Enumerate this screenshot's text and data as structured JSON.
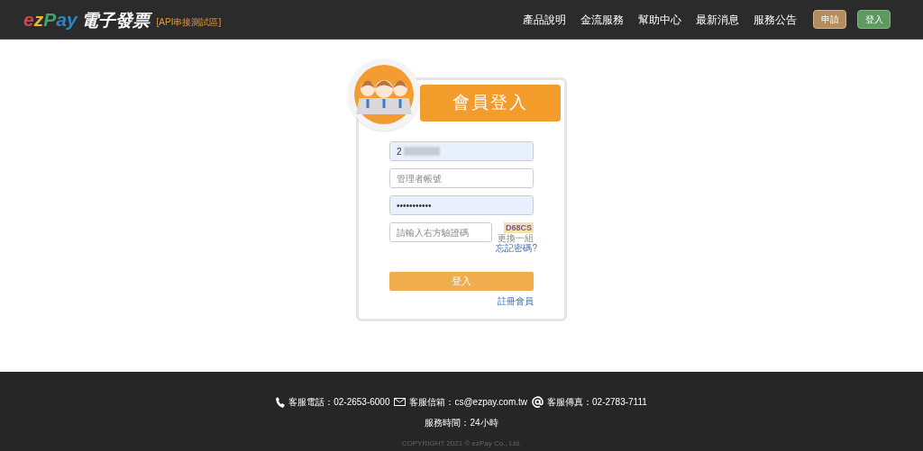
{
  "header": {
    "logo": {
      "letters": [
        {
          "text": "e",
          "color": "#d6424f"
        },
        {
          "text": "z",
          "color": "#e8b730"
        },
        {
          "text": "P",
          "color": "#3fa66b"
        },
        {
          "text": "a",
          "color": "#2a86c8"
        },
        {
          "text": "y",
          "color": "#2a86c8"
        }
      ],
      "title": "電子發票",
      "tag": "[API串接測試區]"
    },
    "nav": [
      "產品說明",
      "金流服務",
      "幫助中心",
      "最新消息",
      "服務公告"
    ],
    "buttons": [
      {
        "label": "申請",
        "kind": "apply"
      },
      {
        "label": "登入",
        "kind": "login"
      }
    ]
  },
  "login": {
    "title": "會員登入",
    "fields": [
      {
        "value": "2",
        "kind": "text",
        "autofilled": true
      },
      {
        "placeholder": "管理者帳號",
        "kind": "text",
        "autofilled": false
      },
      {
        "value": "•••••••••••",
        "kind": "password",
        "autofilled": true
      }
    ],
    "captcha": {
      "placeholder": "請輸入右方驗證碼",
      "code": "D68CS",
      "refresh": "更換一組"
    },
    "forgot": "忘記密碼?",
    "submit": "登入",
    "register": "註冊會員"
  },
  "footer": {
    "contacts": [
      {
        "kind": "phone",
        "label": "客服電話：",
        "value": "02-2653-6000"
      },
      {
        "kind": "mail",
        "label": "客服信箱：",
        "value": "cs@ezpay.com.tw"
      },
      {
        "kind": "at",
        "label": "客服傳真：",
        "value": "02-2783-7111"
      }
    ],
    "hours": "服務時間：24小時",
    "copyright": "COPYRIGHT 2021 © ezPay Co., Ltd."
  }
}
